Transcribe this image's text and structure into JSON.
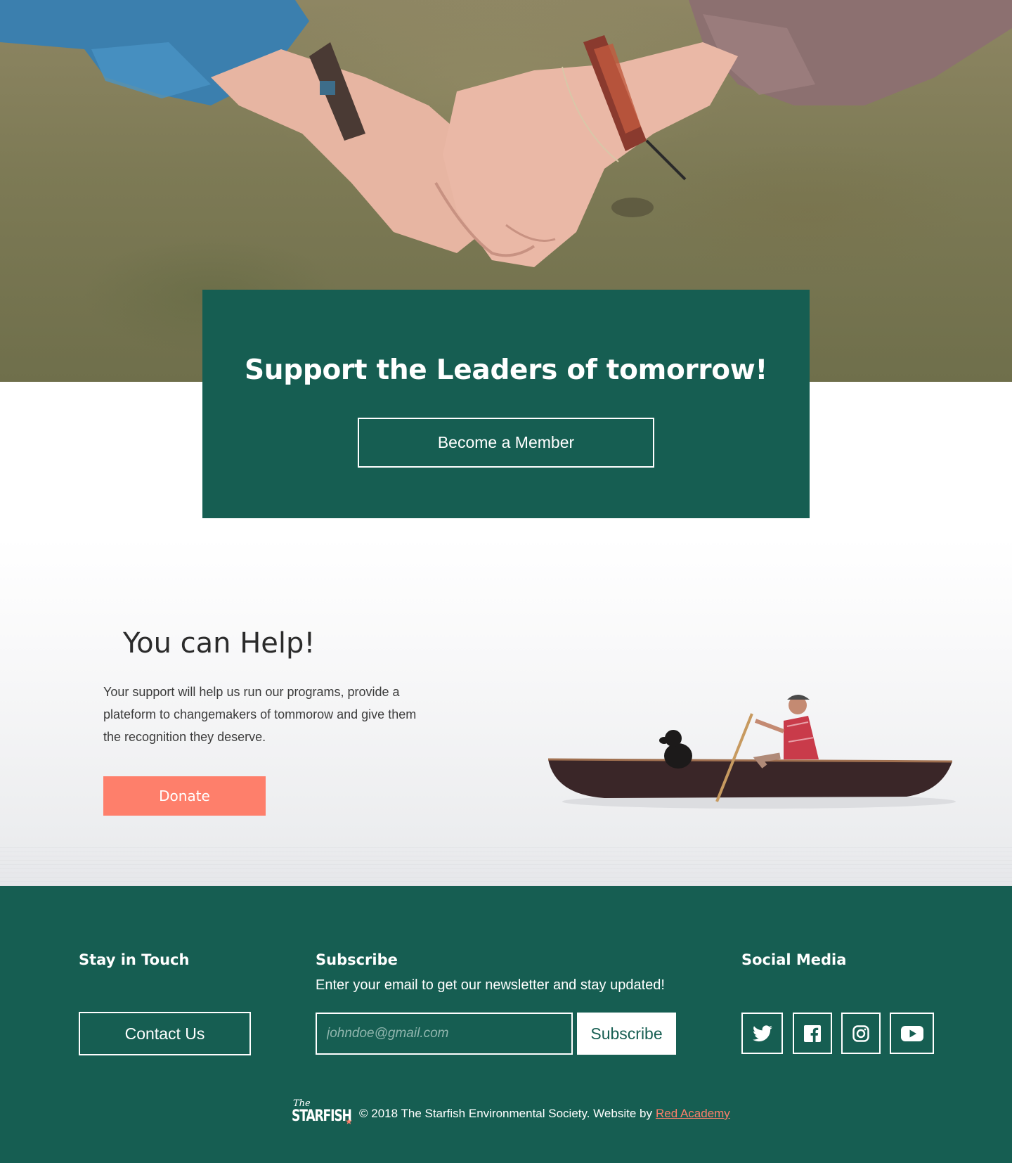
{
  "hero": {
    "image_alt": "two people holding hands over grass",
    "title": "Support the Leaders of tomorrow!",
    "member_button": "Become a Member"
  },
  "help": {
    "title": "You can Help!",
    "body": "Your support will help us run our programs, provide a plateform to changemakers of tommorow and give them the recognition they deserve.",
    "donate_button": "Donate",
    "image_alt": "man paddling a canoe with a dog on a calm lake"
  },
  "footer": {
    "contact": {
      "heading": "Stay in Touch",
      "button": "Contact Us"
    },
    "subscribe": {
      "heading": "Subscribe",
      "description": "Enter your email to get our newsletter and stay updated!",
      "placeholder": "johndoe@gmail.com",
      "button": "Subscribe"
    },
    "social": {
      "heading": "Social Media",
      "icons": [
        "twitter-icon",
        "facebook-icon",
        "instagram-icon",
        "youtube-icon"
      ]
    },
    "logo": {
      "the": "The",
      "name": "STARFISH",
      "star": "★"
    },
    "copyright": "© 2018 The Starfish Environmental Society. Website by",
    "credit_link": "Red Academy"
  },
  "colors": {
    "brand_green": "#165e52",
    "accent_coral": "#fe7f6b",
    "white": "#ffffff"
  }
}
